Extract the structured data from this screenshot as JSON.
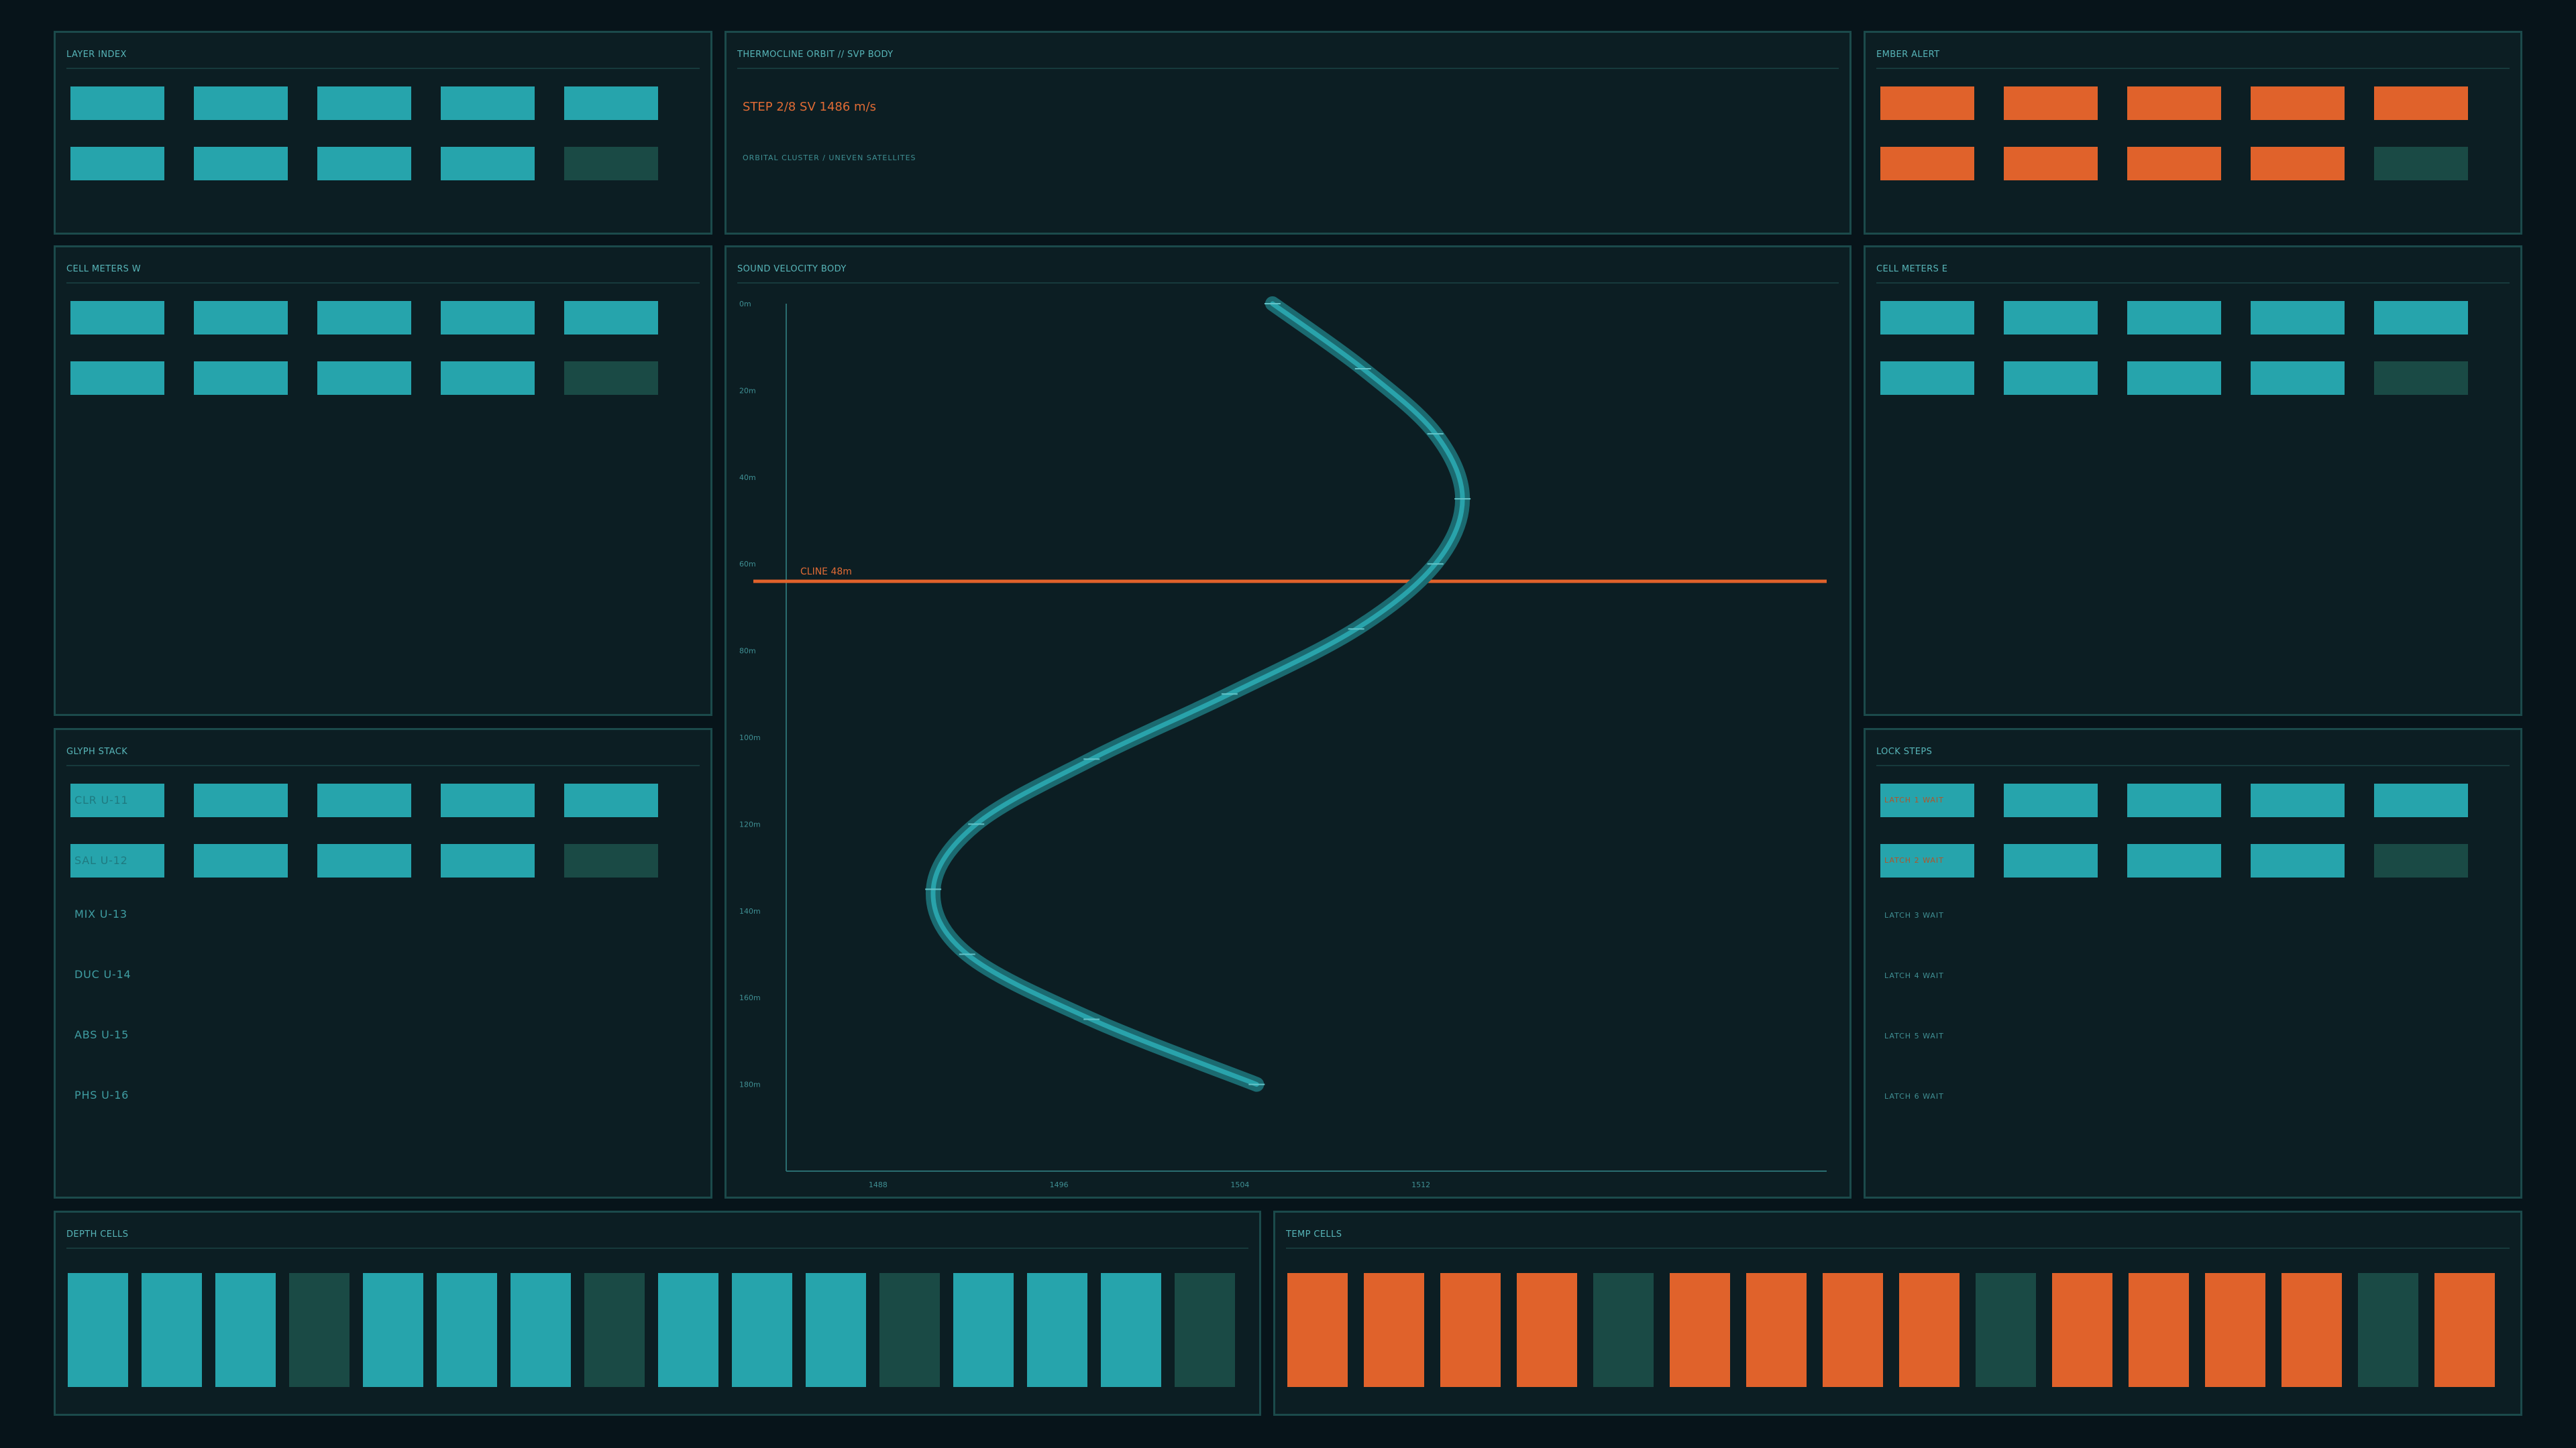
{
  "panels": {
    "layer_index": {
      "title": "LAYER INDEX"
    },
    "orbit": {
      "title": "THERMOCLINE ORBIT  //  SVP BODY",
      "step_text": "STEP 2/8   SV 1486 m/s",
      "sub_text": "ORBITAL CLUSTER  /  UNEVEN SATELLITES"
    },
    "ember_alert": {
      "title": "EMBER ALERT"
    },
    "cell_meters_w": {
      "title": "CELL METERS W"
    },
    "cell_meters_e": {
      "title": "CELL METERS E"
    },
    "glyph_stack": {
      "title": "GLYPH STACK",
      "items": [
        "CLR U-11",
        "SAL U-12",
        "MIX U-13",
        "DUC U-14",
        "ABS U-15",
        "PHS U-16"
      ]
    },
    "lock_steps": {
      "title": "LOCK STEPS",
      "items": [
        "LATCH 1 WAIT",
        "LATCH 2 WAIT",
        "LATCH 3 WAIT",
        "LATCH 4 WAIT",
        "LATCH 5 WAIT",
        "LATCH 6 WAIT"
      ]
    },
    "depth_cells": {
      "title": "DEPTH CELLS"
    },
    "temp_cells": {
      "title": "TEMP CELLS"
    },
    "svp": {
      "title": "SOUND VELOCITY BODY",
      "thermocline_label": "CLINE 48m"
    }
  },
  "chart_data": {
    "type": "line",
    "title": "SOUND VELOCITY BODY",
    "x_ticks": [
      "1488",
      "1496",
      "1504",
      "1512"
    ],
    "y_ticks": [
      "0m",
      "20m",
      "40m",
      "60m",
      "80m",
      "100m",
      "120m",
      "140m",
      "160m",
      "180m"
    ],
    "xlim": [
      1484,
      1530
    ],
    "ylim": [
      0,
      200
    ],
    "thermocline_depth": 64,
    "thermocline_label": "CLINE 48m",
    "series": [
      {
        "x": [
          1505.5,
          1509.5,
          1512.7,
          1513.9,
          1512.7,
          1509.2,
          1503.6,
          1497.5,
          1492.4,
          1490.5,
          1492.0,
          1497.5,
          1504.8
        ],
        "y": [
          0,
          15,
          30,
          45,
          60,
          75,
          90,
          105,
          120,
          135,
          150,
          165,
          180
        ]
      }
    ],
    "colors": {
      "line": "#29a3ab",
      "halo": "#1b6a70",
      "thermocline": "#e0622b"
    }
  },
  "colors": {
    "teal": "#26a4ac",
    "orange": "#e0622b",
    "dim": "#1a4a45",
    "panel": "#0c1e23",
    "border": "#1b4a4b"
  }
}
